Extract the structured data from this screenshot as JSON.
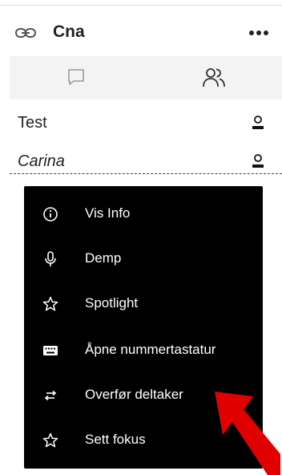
{
  "header": {
    "title": "Cna"
  },
  "participants": [
    {
      "name": "Test"
    },
    {
      "name": "Carina"
    }
  ],
  "menu": {
    "items": [
      {
        "label": "Vis Info"
      },
      {
        "label": "Demp"
      },
      {
        "label": "Spotlight"
      },
      {
        "label": "Åpne nummertastatur"
      },
      {
        "label": "Overfør deltaker"
      },
      {
        "label": "Sett fokus"
      }
    ]
  },
  "colors": {
    "menu_background": "#000000",
    "menu_text": "#ffffff",
    "arrow": "#e00000",
    "tab_bar": "#f3f3f3"
  }
}
